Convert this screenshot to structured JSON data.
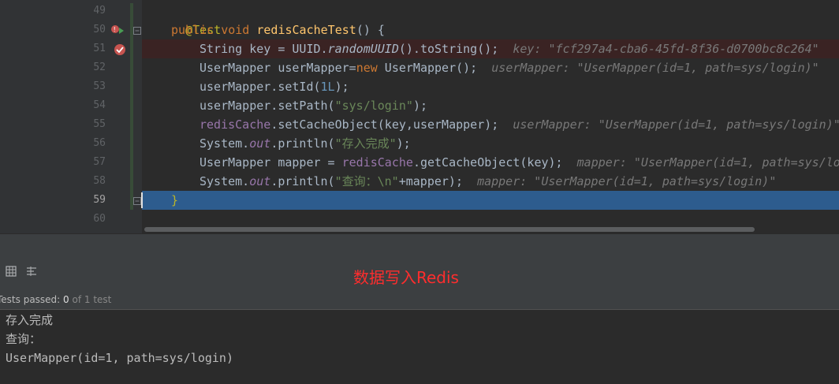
{
  "editor": {
    "lines": [
      {
        "num": "49"
      },
      {
        "num": "50"
      },
      {
        "num": "51"
      },
      {
        "num": "52"
      },
      {
        "num": "53"
      },
      {
        "num": "54"
      },
      {
        "num": "55"
      },
      {
        "num": "56"
      },
      {
        "num": "57"
      },
      {
        "num": "58"
      },
      {
        "num": "59"
      },
      {
        "num": "60"
      }
    ],
    "tokens": {
      "l49_ann": "@Test",
      "l50_kw": "public void ",
      "l50_fn": "redisCacheTest",
      "l50_rest": "() {",
      "l51_code_a": "String key = UUID.",
      "l51_italic": "randomUUID",
      "l51_code_b": "().toString();",
      "l51_hint": "key: \"fcf297a4-cba6-45fd-8f36-d0700bc8c264\"",
      "l52_code_a": "UserMapper userMapper=",
      "l52_kw": "new",
      "l52_code_b": " UserMapper();",
      "l52_hint": "userMapper: \"UserMapper(id=1, path=sys/login)\"",
      "l53_code_a": "userMapper.setId(",
      "l53_num": "1L",
      "l53_code_b": ");",
      "l54_code_a": "userMapper.setPath(",
      "l54_str": "\"sys/login\"",
      "l54_code_b": ");",
      "l55_field": "redisCache",
      "l55_code": ".setCacheObject(key,userMapper);",
      "l55_hint": "userMapper: \"UserMapper(id=1, path=sys/login)\"",
      "l56_code_a": "System.",
      "l56_static": "out",
      "l56_code_b": ".println(",
      "l56_str": "\"存入完成\"",
      "l56_code_c": ");",
      "l57_code_a": "UserMapper mapper = ",
      "l57_field": "redisCache",
      "l57_code_b": ".getCacheObject(key);",
      "l57_hint": "mapper: \"UserMapper(id=1, path=sys/lo",
      "l58_code_a": "System.",
      "l58_static": "out",
      "l58_code_b": ".println(",
      "l58_str": "\"查询：\\n\"",
      "l58_code_c": "+mapper);",
      "l58_hint": "mapper: \"UserMapper(id=1, path=sys/login)\"",
      "l59_brace": "}"
    }
  },
  "run_panel": {
    "status_prefix": "Tests passed: ",
    "status_passed": "0",
    "status_suffix": " of 1 test",
    "toolbar_icons": [
      "table-icon",
      "sort-icon"
    ]
  },
  "console": {
    "lines": [
      "存入完成",
      "查询：",
      "UserMapper(id=1, path=sys/login)"
    ]
  },
  "caption": "数据写入Redis",
  "colors": {
    "keyword": "#cc7832",
    "annotation": "#bbb529",
    "method": "#ffc66d",
    "string": "#6a8759",
    "number": "#6897bb",
    "field": "#9876aa",
    "hint": "#787878",
    "current_line": "#2d5c8e",
    "breakpoint": "#c75450",
    "caption": "#ff2d2d"
  }
}
